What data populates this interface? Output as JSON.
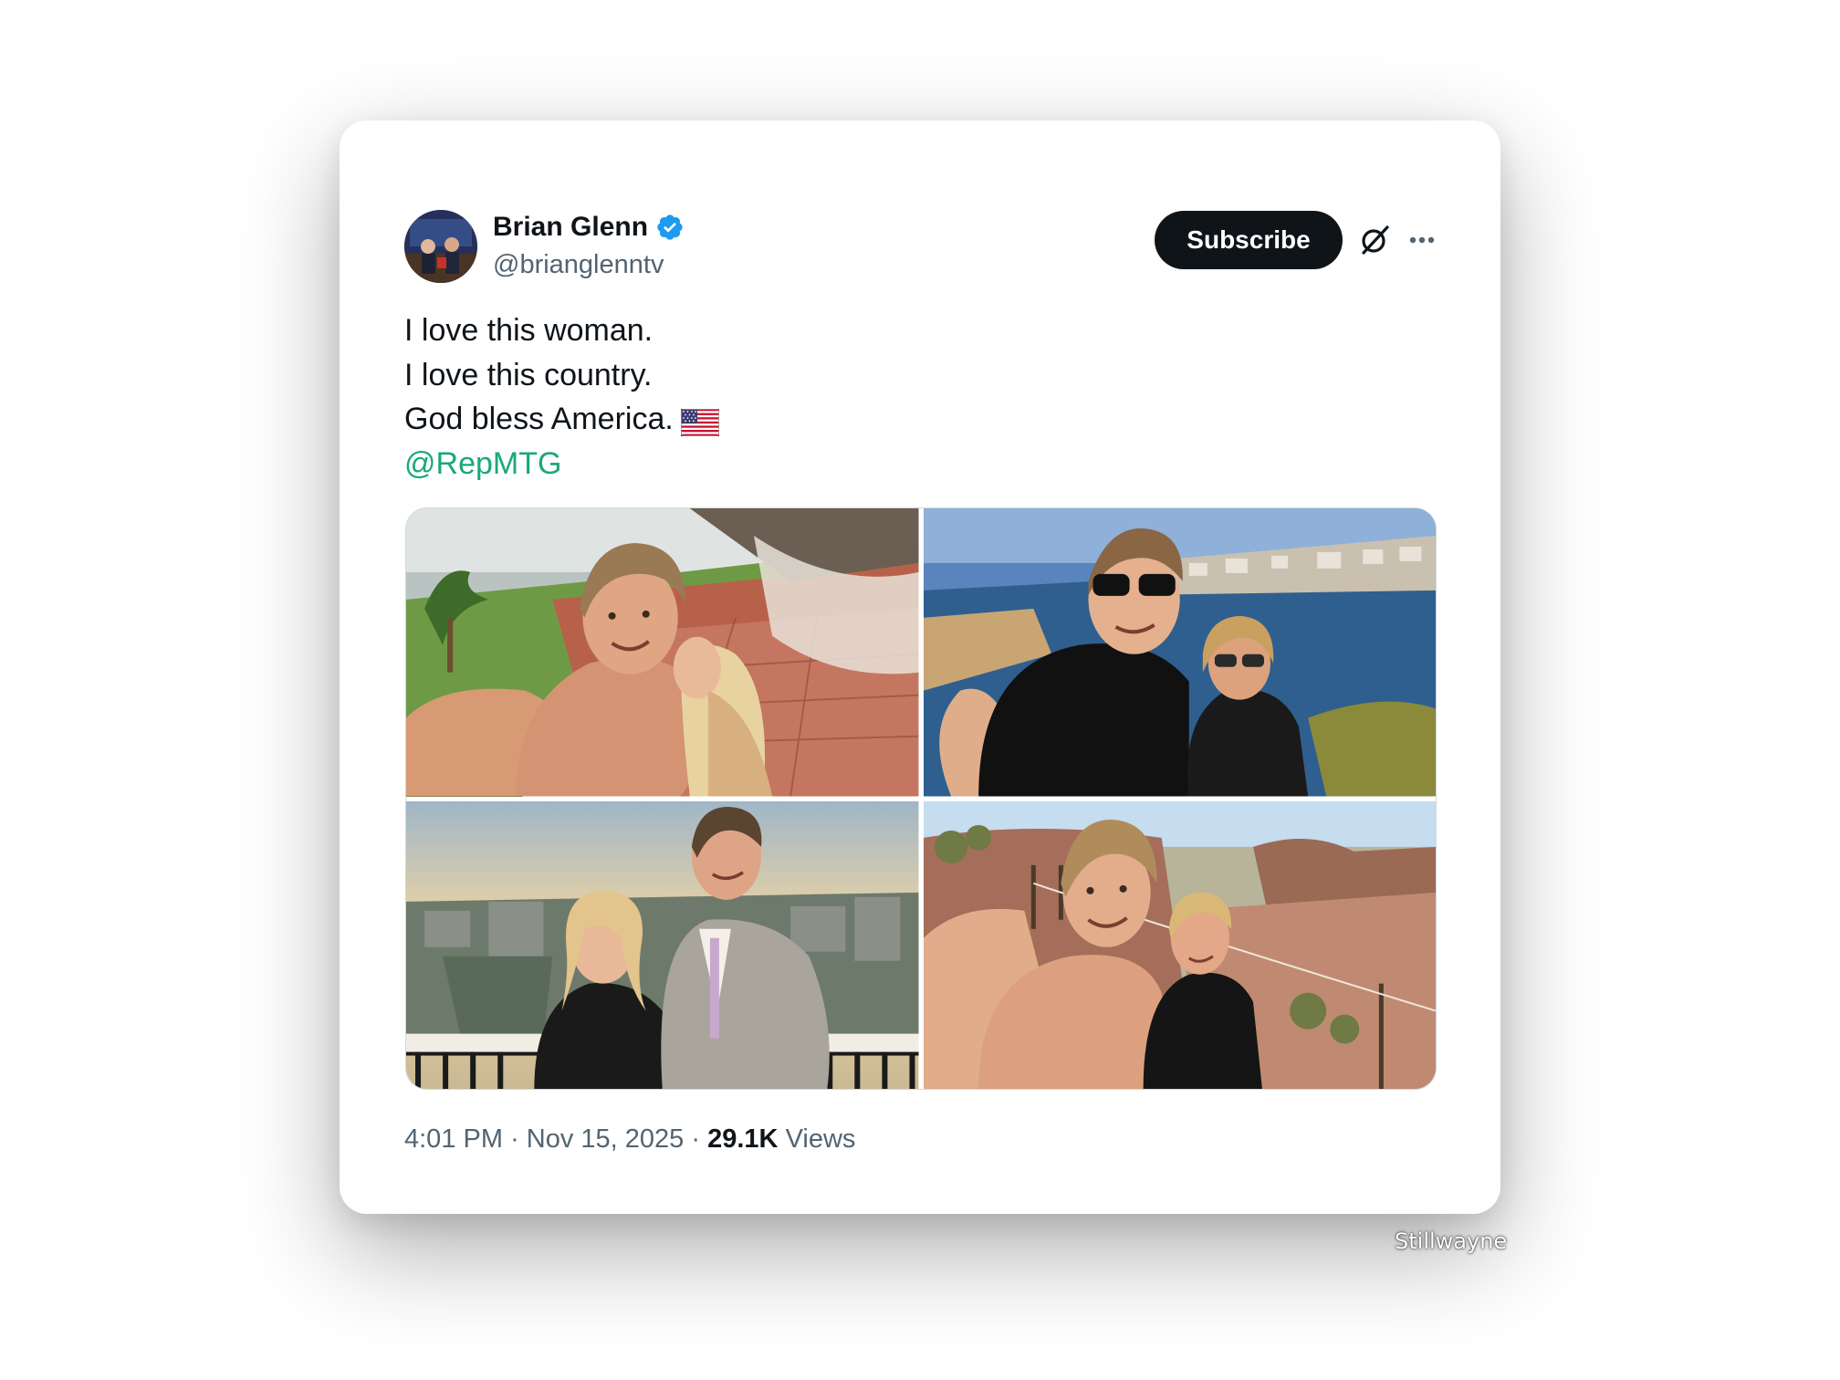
{
  "author": {
    "name": "Brian Glenn",
    "handle": "@brianglenntv",
    "verified": true
  },
  "actions": {
    "subscribe_label": "Subscribe",
    "grok_icon": "grok-icon",
    "more_icon": "more-icon"
  },
  "tweet": {
    "lines": [
      "I love this woman.",
      "I love this country.",
      "God bless America."
    ],
    "flag_icon": "us-flag-emoji",
    "mention": "@RepMTG"
  },
  "media": {
    "count": 4
  },
  "meta": {
    "time": "4:01 PM",
    "separator": "·",
    "date": "Nov 15, 2025",
    "views_count": "29.1K",
    "views_label": "Views"
  },
  "watermark": "Stillwayne",
  "colors": {
    "verified": "#1d9bf0",
    "mention": "#1aa87a",
    "subscribe_bg": "#0f1419",
    "secondary_text": "#536471"
  }
}
